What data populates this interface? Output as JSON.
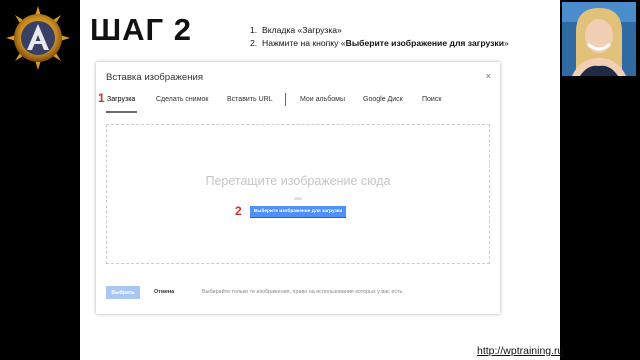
{
  "slide": {
    "step_title": "ШАГ 2",
    "instructions": [
      {
        "number": "1.",
        "text": "Вкладка «Загрузка»"
      },
      {
        "number": "2.",
        "prefix": "Нажмите на кнопку «",
        "bold": "Выберите изображение для загрузки",
        "suffix": "»"
      }
    ]
  },
  "dialog": {
    "title": "Вставка изображения",
    "close_symbol": "×",
    "tabs": [
      {
        "label": "Загрузка",
        "active": true
      },
      {
        "label": "Сделать снимок"
      },
      {
        "label": "Вставить URL"
      },
      {
        "label": "Мои альбомы"
      },
      {
        "label": "Google Диск"
      },
      {
        "label": "Поиск"
      }
    ],
    "drop_text": "Перетащите изображение сюда",
    "or_text": "или",
    "upload_button": "Выберите изображение для загрузки",
    "select_button": "Выбрать",
    "cancel_button": "Отмена",
    "footer_note": "Выбирайте только те изображения, право на использование которых у вас есть."
  },
  "markers": {
    "tab": "1",
    "button": "2"
  },
  "site_url": "http://wptraining.ru",
  "colors": {
    "marker_red": "#d32f2f",
    "upload_blue": "#4d90fe",
    "select_disabled": "#a9c7f6"
  },
  "icons": {
    "logo": "wptraining-logo-icon",
    "presenter": "presenter-webcam-photo",
    "close": "close-icon"
  }
}
